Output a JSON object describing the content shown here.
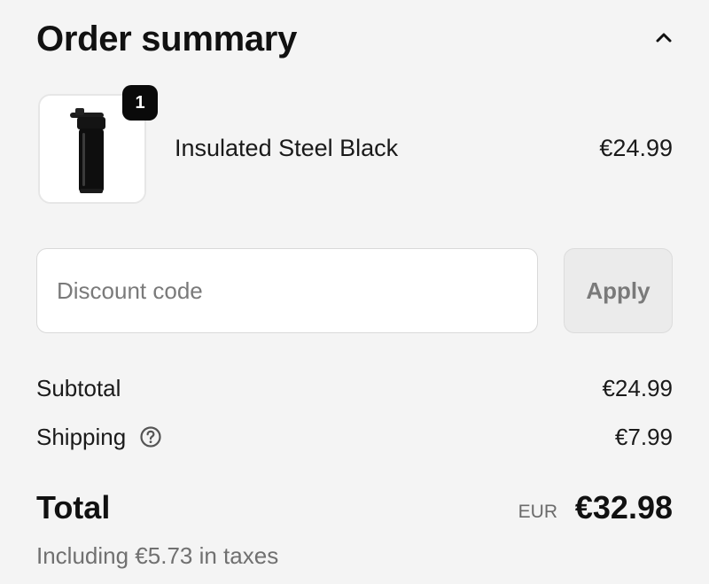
{
  "header": {
    "title": "Order summary",
    "collapse_icon": "chevron-up-icon"
  },
  "product": {
    "name": "Insulated Steel Black",
    "price": "€24.99",
    "quantity": "1",
    "image_icon": "shaker-bottle-icon"
  },
  "discount": {
    "placeholder": "Discount code",
    "value": "",
    "apply_label": "Apply"
  },
  "summary": {
    "subtotal_label": "Subtotal",
    "subtotal_value": "€24.99",
    "shipping_label": "Shipping",
    "shipping_value": "€7.99",
    "shipping_help_icon": "question-circle-icon",
    "total_label": "Total",
    "currency": "EUR",
    "total_value": "€32.98",
    "taxes_note": "Including €5.73 in taxes"
  }
}
